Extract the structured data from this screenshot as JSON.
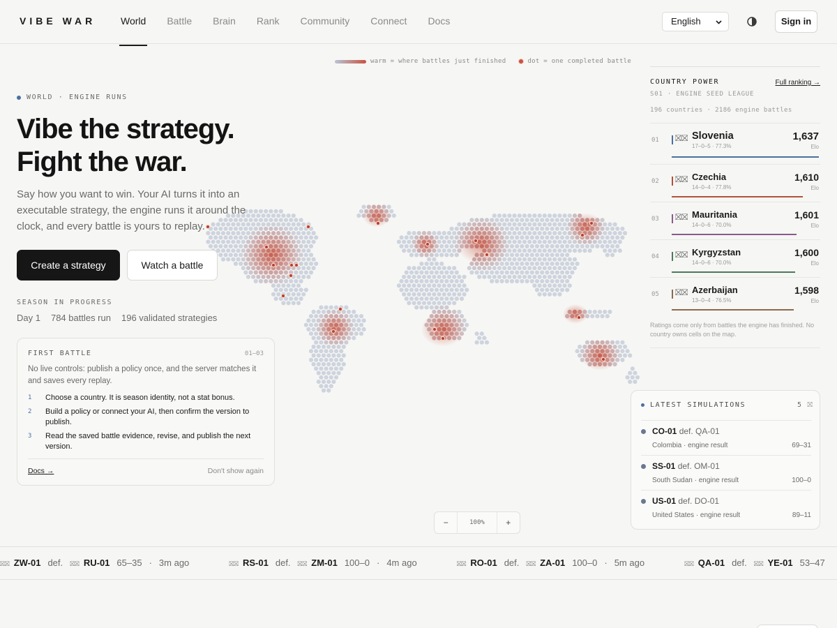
{
  "header": {
    "brand": "VIBE WAR",
    "nav": [
      "World",
      "Battle",
      "Brain",
      "Rank",
      "Community",
      "Connect",
      "Docs"
    ],
    "active_nav": "World",
    "language": "English",
    "theme_icon": "half-circle-icon",
    "signin_label": "Sign in"
  },
  "legend": {
    "warm": "warm = where battles just finished",
    "dot": "dot = one completed battle"
  },
  "hero": {
    "eyebrow": "WORLD · ENGINE RUNS",
    "title_line1": "Vibe the strategy.",
    "title_line2": "Fight the war.",
    "body": "Say how you want to win. Your AI turns it into an executable strategy, the engine runs it around the clock, and every battle is yours to replay.",
    "primary_button": "Create a strategy",
    "secondary_button": "Watch a battle",
    "season_label": "SEASON IN PROGRESS",
    "stats": [
      "Day 1",
      "784 battles run",
      "196 validated strategies"
    ]
  },
  "first_battle": {
    "title": "FIRST BATTLE",
    "count": "01–03",
    "description": "No live controls: publish a policy once, and the server matches it and saves every replay.",
    "steps": [
      {
        "num": "1",
        "text": "Choose a country. It is season identity, not a stat bonus."
      },
      {
        "num": "2",
        "text": "Build a policy or connect your AI, then confirm the version to publish."
      },
      {
        "num": "3",
        "text": "Read the saved battle evidence, revise, and publish the next version."
      }
    ],
    "docs_link": "Docs →",
    "dismiss": "Don't show again"
  },
  "country_power": {
    "title": "COUNTRY POWER",
    "link": "Full ranking →",
    "subtitle": "S01 · ENGINE SEED LEAGUE",
    "meta": "196 countries · 2186 engine battles",
    "rows": [
      {
        "rank": "01",
        "flag": "⛝⛝",
        "name": "Slovenia",
        "record": "17–0–5 · 77.3%",
        "elo": "1,637",
        "elo_label": "Elo",
        "color": "#4a6fa0",
        "level": 1.0
      },
      {
        "rank": "02",
        "flag": "⛝⛝",
        "name": "Czechia",
        "record": "14–0–4 · 77.8%",
        "elo": "1,610",
        "elo_label": "Elo",
        "color": "#b2503a",
        "level": 0.89
      },
      {
        "rank": "03",
        "flag": "⛝⛝",
        "name": "Mauritania",
        "record": "14–0–6 · 70.0%",
        "elo": "1,601",
        "elo_label": "Elo",
        "color": "#8a5a8a",
        "level": 0.85
      },
      {
        "rank": "04",
        "flag": "⛝⛝",
        "name": "Kyrgyzstan",
        "record": "14–0–6 · 70.0%",
        "elo": "1,600",
        "elo_label": "Elo",
        "color": "#4a7a5a",
        "level": 0.84
      },
      {
        "rank": "05",
        "flag": "⛝⛝",
        "name": "Azerbaijan",
        "record": "13–0–4 · 76.5%",
        "elo": "1,598",
        "elo_label": "Elo",
        "color": "#8a6a4a",
        "level": 0.83
      }
    ],
    "note": "Ratings come only from battles the engine has finished. No country owns cells on the map."
  },
  "latest_simulations": {
    "title": "LATEST SIMULATIONS",
    "count": "5",
    "close_icon": "⛝",
    "items": [
      {
        "winner": "CO-01",
        "def": "def.",
        "loser": "QA-01",
        "sub": "Colombia · engine result",
        "score": "69–31"
      },
      {
        "winner": "SS-01",
        "def": "def.",
        "loser": "OM-01",
        "sub": "South Sudan · engine result",
        "score": "100–0"
      },
      {
        "winner": "US-01",
        "def": "def.",
        "loser": "DO-01",
        "sub": "United States · engine result",
        "score": "89–11"
      }
    ]
  },
  "zoom": {
    "minus": "−",
    "value": "100%",
    "plus": "+"
  },
  "ticker": [
    {
      "flag_a": "⛝⛝",
      "a": "ZW-01",
      "def": "def.",
      "flag_b": "⛝⛝",
      "b": "RU-01",
      "score": "65–35",
      "sep": "·",
      "time": "3m ago"
    },
    {
      "flag_a": "⛝⛝",
      "a": "RS-01",
      "def": "def.",
      "flag_b": "⛝⛝",
      "b": "ZM-01",
      "score": "100–0",
      "sep": "·",
      "time": "4m ago"
    },
    {
      "flag_a": "⛝⛝",
      "a": "RO-01",
      "def": "def.",
      "flag_b": "⛝⛝",
      "b": "ZA-01",
      "score": "100–0",
      "sep": "·",
      "time": "5m ago"
    },
    {
      "flag_a": "⛝⛝",
      "a": "QA-01",
      "def": "def.",
      "flag_b": "⛝⛝",
      "b": "YE-01",
      "score": "53–47",
      "sep": "",
      "time": ""
    }
  ]
}
